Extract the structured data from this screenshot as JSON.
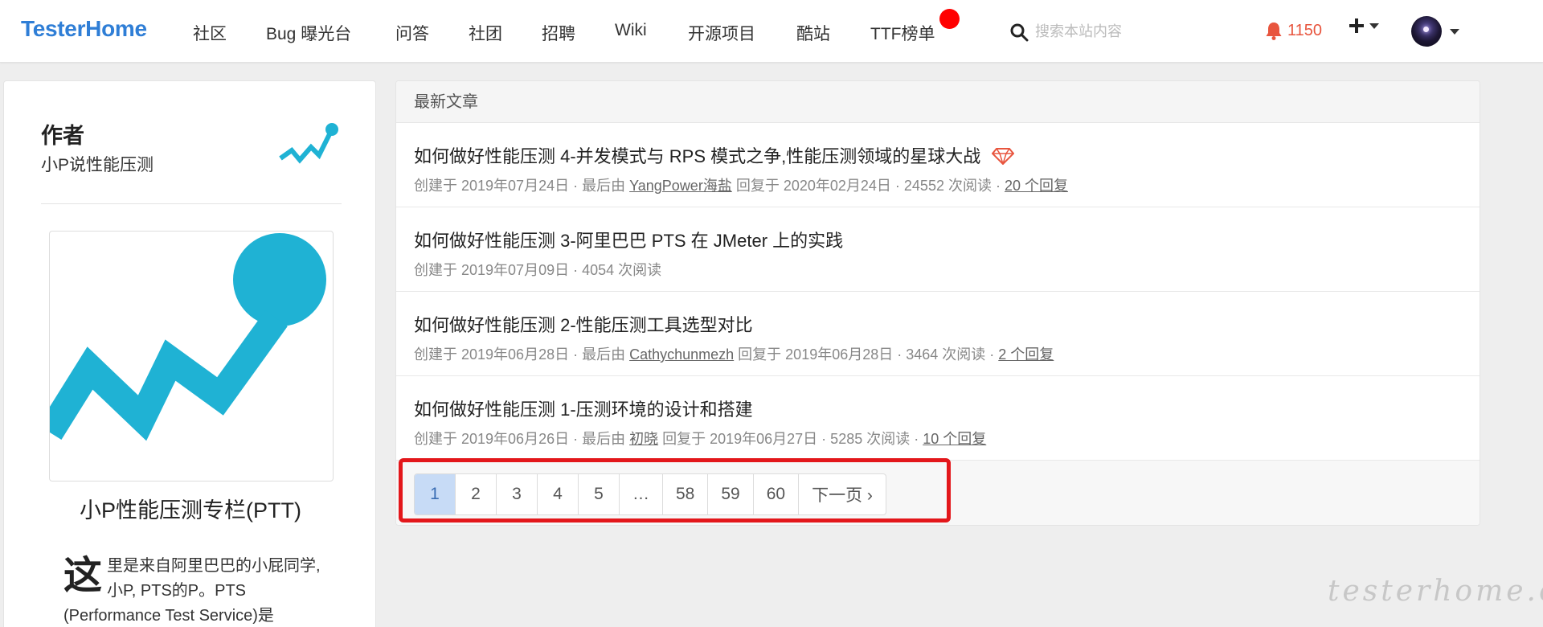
{
  "nav": {
    "brand": "TesterHome",
    "items": [
      "社区",
      "Bug 曝光台",
      "问答",
      "社团",
      "招聘",
      "Wiki",
      "开源项目",
      "酷站",
      "TTF榜单"
    ],
    "search_placeholder": "搜索本站内容",
    "notification_count": "1150",
    "accent_color": "#2f7ed6",
    "badge_color": "#ff0000",
    "icons": [
      "search-icon",
      "bell-icon",
      "plus-icon",
      "chevron-down-icon"
    ]
  },
  "sidebar": {
    "title": "作者",
    "subtitle": "小P说性能压测",
    "column_name": "小P性能压测专栏(PTT)",
    "intro_first_char": "这",
    "intro_text": "里是来自阿里巴巴的小屁同学,小P, PTS的P。PTS (Performance Test Service)是"
  },
  "main": {
    "section_title": "最新文章",
    "topics": [
      {
        "title": "如何做好性能压测 4-并发模式与 RPS 模式之争,性能压测领域的星球大战",
        "meta_created": "创建于 2019年07月24日 · 最后由 ",
        "meta_user": "YangPower海盐",
        "meta_reply": " 回复于 2020年02月24日 · 24552 次阅读 · ",
        "meta_replies": "20 个回复",
        "has_diamond": true
      },
      {
        "title": "如何做好性能压测 3-阿里巴巴 PTS 在 JMeter 上的实践",
        "meta_created": "创建于 2019年07月09日 · 4054 次阅读",
        "meta_user": "",
        "meta_reply": "",
        "meta_replies": ""
      },
      {
        "title": "如何做好性能压测 2-性能压测工具选型对比",
        "meta_created": "创建于 2019年06月28日 · 最后由 ",
        "meta_user": "Cathychunmezh",
        "meta_reply": " 回复于 2019年06月28日 · 3464 次阅读 · ",
        "meta_replies": "2 个回复"
      },
      {
        "title": "如何做好性能压测 1-压测环境的设计和搭建",
        "meta_created": "创建于 2019年06月26日 · 最后由 ",
        "meta_user": "初晓",
        "meta_reply": " 回复于 2019年06月27日 · 5285 次阅读 · ",
        "meta_replies": "10 个回复"
      }
    ],
    "pagination": [
      "1",
      "2",
      "3",
      "4",
      "5",
      "…",
      "58",
      "59",
      "60",
      "下一页 ›"
    ],
    "active_page": "1"
  },
  "watermark": "testerhome.com"
}
